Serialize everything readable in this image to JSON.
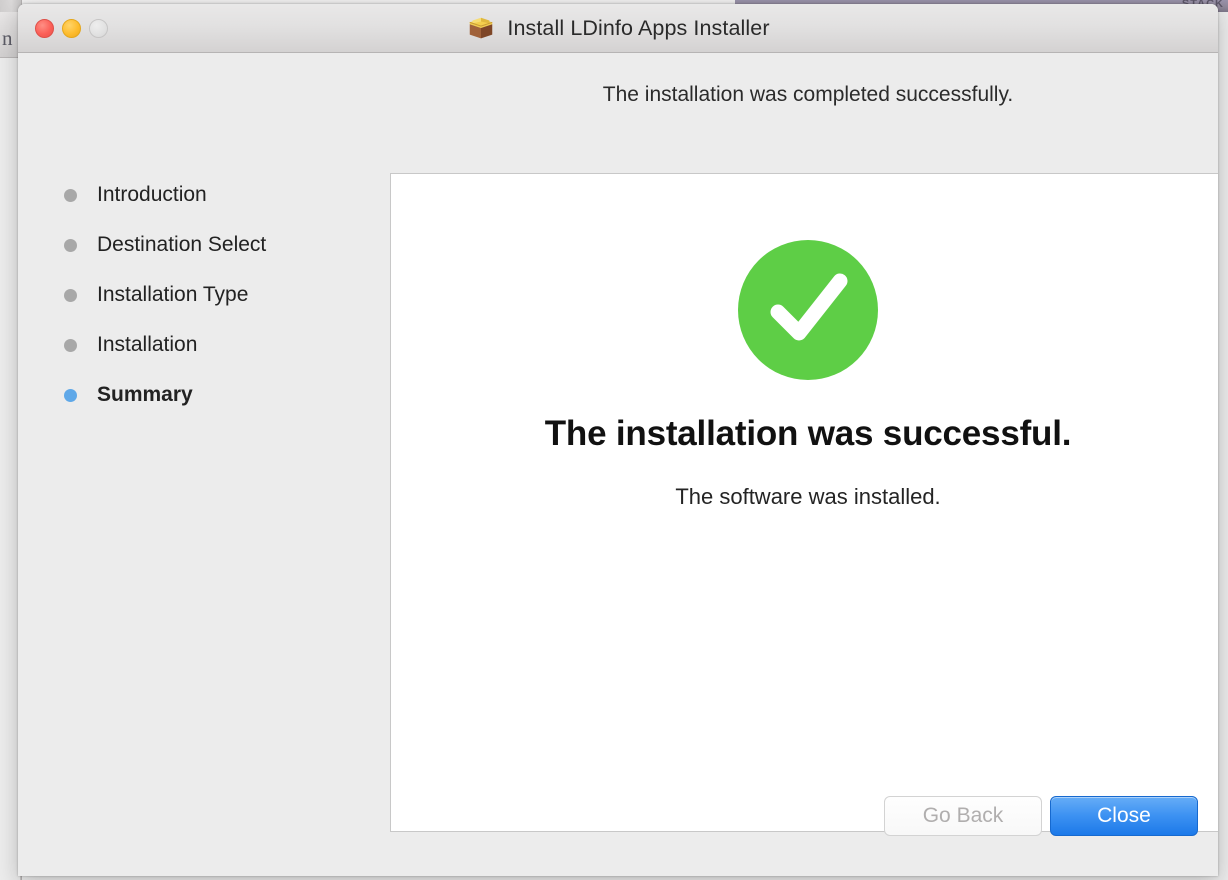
{
  "window": {
    "title": "Install LDinfo Apps Installer",
    "icon": "package-box-icon",
    "traffic_lights": {
      "close_label": "close",
      "minimize_label": "minimize",
      "zoom_label": "zoom"
    }
  },
  "background": {
    "purple_band_text": "STACK"
  },
  "header": {
    "text": "The installation was completed successfully."
  },
  "sidebar": {
    "steps": [
      {
        "label": "Introduction",
        "state": "done"
      },
      {
        "label": "Destination Select",
        "state": "done"
      },
      {
        "label": "Installation Type",
        "state": "done"
      },
      {
        "label": "Installation",
        "state": "done"
      },
      {
        "label": "Summary",
        "state": "active"
      }
    ]
  },
  "content": {
    "status_icon": "green-check-circle-icon",
    "title": "The installation was successful.",
    "subtitle": "The software was installed."
  },
  "footer": {
    "go_back_label": "Go Back",
    "close_label": "Close"
  },
  "colors": {
    "accent_blue": "#5fa8e8",
    "success_green": "#5ece46",
    "default_button_blue": "#3d92f2",
    "window_background": "#ececec",
    "panel_background": "#ffffff"
  }
}
